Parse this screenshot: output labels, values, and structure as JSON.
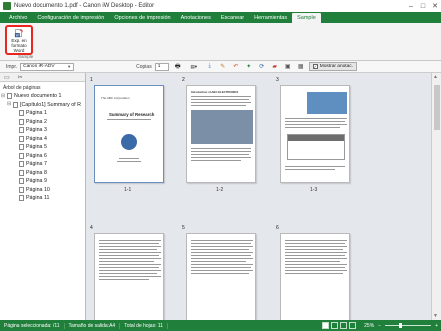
{
  "window": {
    "title": "Nuevo documento 1.pdf - Canon iW Desktop - Editor",
    "min": "–",
    "max": "□",
    "close": "✕"
  },
  "menu": {
    "tabs": [
      "Archivo",
      "Configuración de impresión",
      "Opciones de impresión",
      "Anotaciones",
      "Escanear",
      "Herramientas",
      "Sample"
    ],
    "active_index": 6
  },
  "ribbon": {
    "button_label": "Exp. en formato Word",
    "group_label": "Sample",
    "highlight_color": "#e8261f"
  },
  "toolbar": {
    "printer_label": "Impr.",
    "printer_value": "Canon iR-ADV",
    "copies_label": "Copias",
    "copies_value": "1",
    "show_annotations_label": "Mostrar anotac."
  },
  "tree": {
    "header": "Árbol de páginas",
    "root": "Nuevo documento 1",
    "chapter": "[Capítulo1] Summary of R",
    "pages": [
      "Página 1",
      "Página 2",
      "Página 3",
      "Página 4",
      "Página 5",
      "Página 6",
      "Página 7",
      "Página 8",
      "Página 9",
      "Página 10",
      "Página 11"
    ]
  },
  "thumbnails": [
    {
      "num": "1",
      "label": "1-1",
      "title": "Summary of Research",
      "org": "The ABC Corporation"
    },
    {
      "num": "2",
      "label": "1-2",
      "title": "Introduction of ABC ELECTRONICS"
    },
    {
      "num": "3",
      "label": "1-3"
    },
    {
      "num": "4",
      "label": ""
    },
    {
      "num": "5",
      "label": ""
    },
    {
      "num": "6",
      "label": ""
    }
  ],
  "status": {
    "selected": "Página seleccionada: /11",
    "output_size": "Tamaño de salida:A4",
    "total": "Total de hojas: 11",
    "zoom": "25%"
  },
  "colors": {
    "brand_green": "#1f7f3b",
    "ribbon_bg": "#f3f3f3"
  }
}
